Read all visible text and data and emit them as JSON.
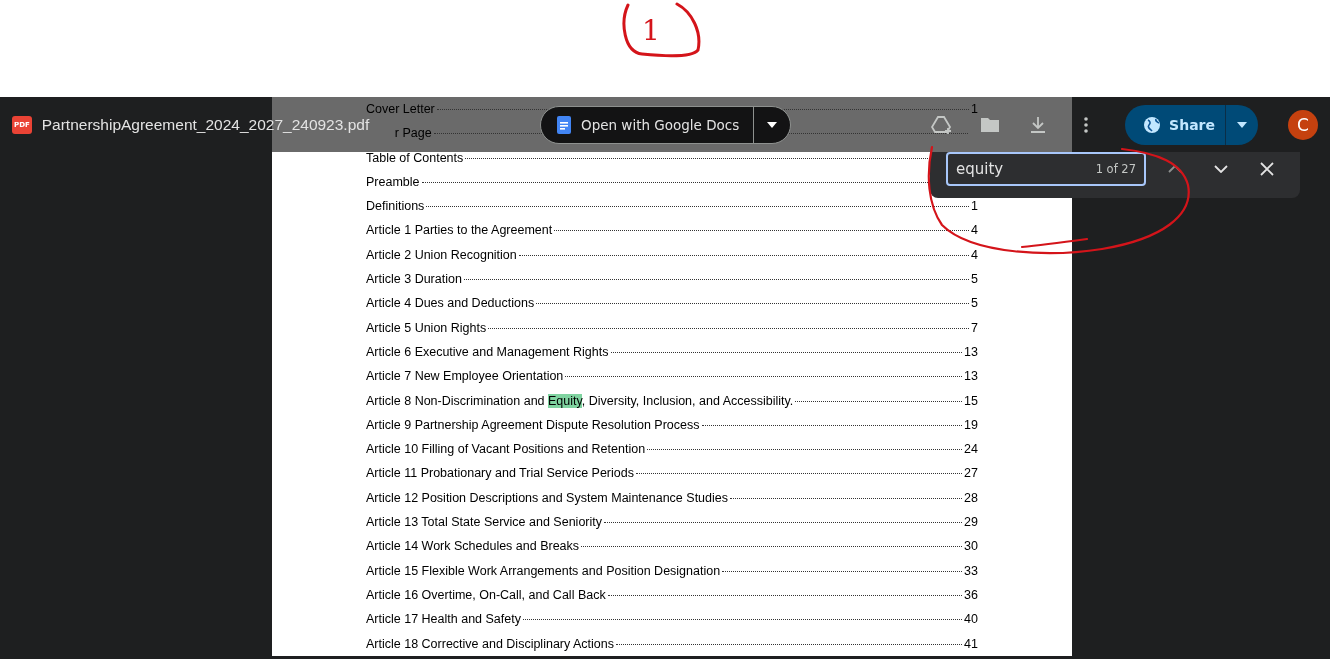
{
  "annotation": {
    "label": "1"
  },
  "file": {
    "name": "PartnershipAgreement_2024_2027_240923.pdf",
    "badge": "PDF"
  },
  "open_with": {
    "label": "Open with Google Docs"
  },
  "share": {
    "label": "Share"
  },
  "avatar": {
    "initial": "C"
  },
  "find": {
    "value": "equity",
    "count": "1 of 27"
  },
  "toc": [
    {
      "segments": [
        {
          "text": "Cover Letter",
          "highlight": false
        }
      ],
      "page": "1"
    },
    {
      "segments": [
        {
          "text": "r Page",
          "highlight": false
        }
      ],
      "start_covered": true
    },
    {
      "segments": [
        {
          "text": "Table of Contents",
          "highlight": false
        }
      ]
    },
    {
      "segments": [
        {
          "text": "Preamble",
          "highlight": false
        }
      ]
    },
    {
      "segments": [
        {
          "text": "Definitions",
          "highlight": false
        }
      ],
      "page": "1"
    },
    {
      "segments": [
        {
          "text": "Article 1 Parties to the Agreement",
          "highlight": false
        }
      ],
      "page": "4"
    },
    {
      "segments": [
        {
          "text": "Article 2 Union Recognition",
          "highlight": false
        }
      ],
      "page": "4"
    },
    {
      "segments": [
        {
          "text": "Article 3 Duration",
          "highlight": false
        }
      ],
      "page": "5"
    },
    {
      "segments": [
        {
          "text": "Article 4 Dues and Deductions",
          "highlight": false
        }
      ],
      "page": "5"
    },
    {
      "segments": [
        {
          "text": "Article 5 Union Rights",
          "highlight": false
        }
      ],
      "page": "7"
    },
    {
      "segments": [
        {
          "text": "Article 6 Executive and Management Rights",
          "highlight": false
        }
      ],
      "page": "13"
    },
    {
      "segments": [
        {
          "text": "Article 7 New Employee Orientation",
          "highlight": false
        }
      ],
      "page": "13"
    },
    {
      "segments": [
        {
          "text": "Article 8 Non-Discrimination and ",
          "highlight": false
        },
        {
          "text": "Equity",
          "highlight": true
        },
        {
          "text": ", Diversity, Inclusion, and Accessibility.",
          "highlight": false
        }
      ],
      "page": "15"
    },
    {
      "segments": [
        {
          "text": "Article 9 Partnership Agreement Dispute Resolution Process",
          "highlight": false
        }
      ],
      "page": "19"
    },
    {
      "segments": [
        {
          "text": "Article 10 Filling of Vacant Positions and Retention",
          "highlight": false
        }
      ],
      "page": "24"
    },
    {
      "segments": [
        {
          "text": "Article 11 Probationary and Trial Service Periods",
          "highlight": false
        }
      ],
      "page": "27"
    },
    {
      "segments": [
        {
          "text": "Article 12 Position Descriptions and System Maintenance Studies",
          "highlight": false
        }
      ],
      "page": "28"
    },
    {
      "segments": [
        {
          "text": "Article 13 Total State Service and Seniority",
          "highlight": false
        }
      ],
      "page": "29"
    },
    {
      "segments": [
        {
          "text": "Article 14 Work Schedules and Breaks",
          "highlight": false
        }
      ],
      "page": "30"
    },
    {
      "segments": [
        {
          "text": "Article 15 Flexible Work Arrangements and Position Designation",
          "highlight": false
        }
      ],
      "page": "33"
    },
    {
      "segments": [
        {
          "text": "Article 16 Overtime, On-Call, and Call Back",
          "highlight": false
        }
      ],
      "page": "36"
    },
    {
      "segments": [
        {
          "text": "Article 17 Health and Safety",
          "highlight": false
        }
      ],
      "page": "40"
    },
    {
      "segments": [
        {
          "text": "Article 18 Corrective and Disciplinary Actions",
          "highlight": false
        }
      ],
      "page": "41"
    }
  ]
}
